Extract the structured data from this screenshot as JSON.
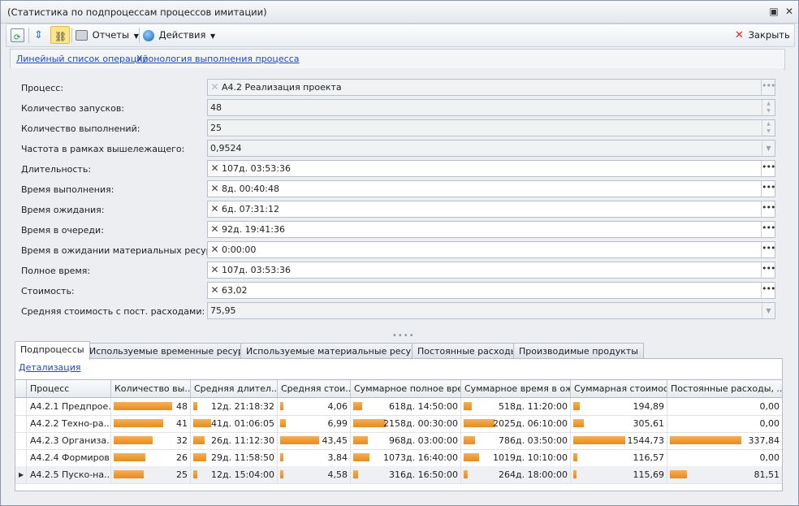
{
  "window": {
    "title": "(Статистика по подпроцессам процессов имитации)",
    "pin_icon": "pin-icon",
    "close_icon": "close-icon"
  },
  "toolbar": {
    "reports_label": "Отчеты",
    "actions_label": "Действия",
    "close_label": "Закрыть"
  },
  "links": {
    "linear_list": "Линейный список операций",
    "chronology": "Хронология выполнения процесса"
  },
  "fields": {
    "process": {
      "label": "Процесс:",
      "value": "А4.2 Реализация проекта"
    },
    "runs": {
      "label": "Количество запусков:",
      "value": "48"
    },
    "executions": {
      "label": "Количество выполнений:",
      "value": "25"
    },
    "frequency": {
      "label": "Частота в рамках вышележащего:",
      "value": "0,9524"
    },
    "duration": {
      "label": "Длительность:",
      "value": "107д. 03:53:36"
    },
    "exec_time": {
      "label": "Время выполнения:",
      "value": "8д. 00:40:48"
    },
    "wait_time": {
      "label": "Время ожидания:",
      "value": "6д. 07:31:12"
    },
    "queue_time": {
      "label": "Время в очереди:",
      "value": "92д. 19:41:36"
    },
    "material_wait": {
      "label": "Время в ожидании материальных ресурсов:",
      "value": "0:00:00"
    },
    "full_time": {
      "label": "Полное время:",
      "value": "107д. 03:53:36"
    },
    "cost": {
      "label": "Стоимость:",
      "value": "63,02"
    },
    "avg_cost": {
      "label": "Средняя стоимость с пост. расходами:",
      "value": "75,95"
    }
  },
  "tabs": [
    {
      "label": "Подпроцессы"
    },
    {
      "label": "Используемые временные ресурсы"
    },
    {
      "label": "Используемые материальные ресурсы"
    },
    {
      "label": "Постоянные расходы"
    },
    {
      "label": "Производимые продукты"
    }
  ],
  "detail_link": "Детализация",
  "grid": {
    "headers": [
      "Процесс",
      "Количество вы...",
      "Средняя длител...",
      "Средняя стои...",
      "Суммарное полное время",
      "Суммарное время в ож...",
      "Суммарная стоимость",
      "Постоянные расходы, ..."
    ],
    "rows": [
      {
        "name": "А4.2.1 Предпрое...",
        "count": "48",
        "count_frac": 1.0,
        "avg_dur": "12д. 21:18:32",
        "avg_dur_frac": 0.22,
        "avg_cost": "4,06",
        "avg_cost_frac": 0.08,
        "total_time": "618д. 14:50:00",
        "total_time_frac": 0.27,
        "wait_total": "518д. 11:20:00",
        "wait_total_frac": 0.26,
        "total_cost": "194,89",
        "total_cost_frac": 0.13,
        "fixed": "0,00",
        "fixed_frac": 0
      },
      {
        "name": "А4.2.2 Техно-ра...",
        "count": "41",
        "count_frac": 0.85,
        "avg_dur": "41д. 01:06:05",
        "avg_dur_frac": 0.92,
        "avg_cost": "6,99",
        "avg_cost_frac": 0.14,
        "total_time": "2158д. 00:30:00",
        "total_time_frac": 1.0,
        "wait_total": "2025д. 06:10:00",
        "wait_total_frac": 1.0,
        "total_cost": "305,61",
        "total_cost_frac": 0.2,
        "fixed": "0,00",
        "fixed_frac": 0
      },
      {
        "name": "А4.2.3 Организа...",
        "count": "32",
        "count_frac": 0.67,
        "avg_dur": "26д. 11:12:30",
        "avg_dur_frac": 0.6,
        "avg_cost": "43,45",
        "avg_cost_frac": 1.0,
        "total_time": "968д. 03:00:00",
        "total_time_frac": 0.44,
        "wait_total": "786д. 03:50:00",
        "wait_total_frac": 0.38,
        "total_cost": "1544,73",
        "total_cost_frac": 1.0,
        "fixed": "337,84",
        "fixed_frac": 1.0
      },
      {
        "name": "А4.2.4 Формиров...",
        "count": "26",
        "count_frac": 0.54,
        "avg_dur": "29д. 11:58:50",
        "avg_dur_frac": 0.68,
        "avg_cost": "3,84",
        "avg_cost_frac": 0.08,
        "total_time": "1073д. 16:40:00",
        "total_time_frac": 0.49,
        "wait_total": "1019д. 10:10:00",
        "wait_total_frac": 0.5,
        "total_cost": "116,57",
        "total_cost_frac": 0.08,
        "fixed": "0,00",
        "fixed_frac": 0
      },
      {
        "name": "А4.2.5 Пуско-на...",
        "count": "25",
        "count_frac": 0.52,
        "avg_dur": "12д. 15:04:00",
        "avg_dur_frac": 0.22,
        "avg_cost": "4,58",
        "avg_cost_frac": 0.09,
        "total_time": "316д. 16:50:00",
        "total_time_frac": 0.14,
        "wait_total": "264д. 18:00:00",
        "wait_total_frac": 0.12,
        "total_cost": "115,69",
        "total_cost_frac": 0.07,
        "fixed": "81,51",
        "fixed_frac": 0.24
      }
    ]
  },
  "colors": {
    "bar": "#f0a040",
    "link": "#1f47c5",
    "close_x": "#d62a1f"
  }
}
